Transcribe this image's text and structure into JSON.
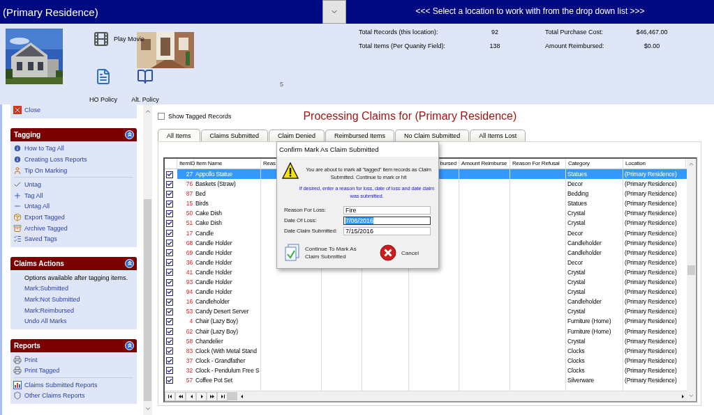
{
  "location_bar": {
    "value": "(Primary Residence)",
    "prompt": "<<< Select a location to work with from the drop down list >>>"
  },
  "header": {
    "launchers": [
      {
        "kind": "movie",
        "label": "Play Movie"
      },
      {
        "kind": "policy",
        "label": "HO Policy"
      },
      {
        "kind": "alt_policy",
        "label": "Alt. Policy"
      }
    ],
    "counter": "5",
    "stats": [
      {
        "label": "Total Records (this location):",
        "value": "92"
      },
      {
        "label": "Total Purchase Cost:",
        "value": "$46,467.00"
      },
      {
        "label": "Total Items (Per Quanity Field):",
        "value": "138"
      },
      {
        "label": "Amount Reimbursed:",
        "value": "$0.00"
      }
    ]
  },
  "sidebar": {
    "top_items": [
      {
        "kind": "close",
        "label": "Close"
      }
    ],
    "sections": [
      {
        "title": "Tagging",
        "groups": [
          [
            {
              "kind": "info",
              "label": "How to Tag All"
            },
            {
              "kind": "info",
              "label": "Creating Loss Reports"
            },
            {
              "kind": "tip",
              "label": "Tip On Marking"
            }
          ],
          [
            {
              "kind": "untag",
              "label": "Untag"
            },
            {
              "kind": "tag_all",
              "label": "Tag All"
            },
            {
              "kind": "untag_all",
              "label": "Untag All"
            },
            {
              "kind": "export",
              "label": "Export Tagged"
            },
            {
              "kind": "archive",
              "label": "Archive Tagged"
            },
            {
              "kind": "saved",
              "label": "Saved Tags"
            }
          ]
        ]
      },
      {
        "title": "Claims Actions",
        "groups": [
          [
            {
              "kind": "note",
              "label": "Options available after tagging items."
            },
            {
              "kind": "link",
              "label": "Mark:Submitted"
            },
            {
              "kind": "link",
              "label": "Mark:Not Submitted"
            },
            {
              "kind": "link",
              "label": "Mark:Reimbursed"
            },
            {
              "kind": "link",
              "label": "Undo All Marks"
            }
          ]
        ]
      },
      {
        "title": "Reports",
        "groups": [
          [
            {
              "kind": "print",
              "label": "Print"
            },
            {
              "kind": "print",
              "label": "Print Tagged"
            }
          ],
          [
            {
              "kind": "chart",
              "label": "Claims Submitted Reports"
            },
            {
              "kind": "shield",
              "label": "Other Claims Reports"
            }
          ]
        ]
      }
    ]
  },
  "show_tagged": {
    "label": "Show Tagged Records",
    "checked": false
  },
  "title": "Processing Claims for (Primary Residence)",
  "tabs": [
    {
      "label": "All Items",
      "selected": true
    },
    {
      "label": "Claims Submitted",
      "selected": false
    },
    {
      "label": "Claim Denied",
      "selected": false
    },
    {
      "label": "Reimbursed Items",
      "selected": false
    },
    {
      "label": "No Claim Submitted",
      "selected": false
    },
    {
      "label": "All Items Lost",
      "selected": false
    }
  ],
  "table": {
    "columns": [
      {},
      {
        "label": "ItemID"
      },
      {
        "label": "Item Name"
      },
      {
        "label": "Reas"
      },
      {},
      {},
      {
        "label": "bursed"
      },
      {
        "label": "Amount Reimburse"
      },
      {
        "label": "Reason For Refusal"
      },
      {
        "label": "Category"
      },
      {
        "label": "Location"
      }
    ],
    "rows": [
      {
        "tagged": true,
        "selected": true,
        "item_id": "27",
        "item_name": "Appollo Statue",
        "category": "Statues",
        "location": "(Primary Residence)"
      },
      {
        "tagged": true,
        "selected": false,
        "item_id": "76",
        "item_name": "Baskets (Straw)",
        "category": "Decor",
        "location": "(Primary Residence)"
      },
      {
        "tagged": true,
        "selected": false,
        "item_id": "87",
        "item_name": "Bed",
        "category": "Bedding",
        "location": "(Primary Residence)"
      },
      {
        "tagged": true,
        "selected": false,
        "item_id": "15",
        "item_name": "Birds",
        "category": "Statues",
        "location": "(Primary Residence)"
      },
      {
        "tagged": true,
        "selected": false,
        "item_id": "50",
        "item_name": "Cake Dish",
        "category": "Crystal",
        "location": "(Primary Residence)"
      },
      {
        "tagged": true,
        "selected": false,
        "item_id": "51",
        "item_name": "Cake Dish",
        "category": "Crystal",
        "location": "(Primary Residence)"
      },
      {
        "tagged": true,
        "selected": false,
        "item_id": "17",
        "item_name": "Candle",
        "category": "Decor",
        "location": "(Primary Residence)"
      },
      {
        "tagged": true,
        "selected": false,
        "item_id": "68",
        "item_name": "Candle Holder",
        "category": "Candleholder",
        "location": "(Primary Residence)"
      },
      {
        "tagged": true,
        "selected": false,
        "item_id": "69",
        "item_name": "Candle Holder",
        "category": "Candleholder",
        "location": "(Primary Residence)"
      },
      {
        "tagged": true,
        "selected": false,
        "item_id": "36",
        "item_name": "Candle Holder",
        "category": "Decor",
        "location": "(Primary Residence)"
      },
      {
        "tagged": true,
        "selected": false,
        "item_id": "41",
        "item_name": "Candle Holder",
        "category": "Crystal",
        "location": "(Primary Residence)"
      },
      {
        "tagged": true,
        "selected": false,
        "item_id": "93",
        "item_name": "Candle Holder",
        "category": "Crystal",
        "location": "(Primary Residence)"
      },
      {
        "tagged": true,
        "selected": false,
        "item_id": "94",
        "item_name": "Candle Holder",
        "category": "Crystal",
        "location": "(Primary Residence)"
      },
      {
        "tagged": true,
        "selected": false,
        "item_id": "16",
        "item_name": "Candleholder",
        "category": "Candleholder",
        "location": "(Primary Residence)"
      },
      {
        "tagged": true,
        "selected": false,
        "item_id": "53",
        "item_name": "Candy Desert Server",
        "category": "Crystal",
        "location": "(Primary Residence)"
      },
      {
        "tagged": true,
        "selected": false,
        "item_id": "4",
        "item_name": "Chair (Lazy Boy)",
        "category": "Furniture (Home)",
        "location": "(Primary Residence)"
      },
      {
        "tagged": true,
        "selected": false,
        "item_id": "62",
        "item_name": "Chair (Lazy Boy)",
        "category": "Furniture (Home)",
        "location": "(Primary Residence)"
      },
      {
        "tagged": true,
        "selected": false,
        "item_id": "58",
        "item_name": "Chandelier",
        "category": "Crystal",
        "location": "(Primary Residence)"
      },
      {
        "tagged": true,
        "selected": false,
        "item_id": "83",
        "item_name": "Clock (With Metal Stand",
        "category": "Clocks",
        "location": "(Primary Residence)"
      },
      {
        "tagged": true,
        "selected": false,
        "item_id": "37",
        "item_name": "Clock - Grandfather",
        "category": "Clocks",
        "location": "(Primary Residence)"
      },
      {
        "tagged": true,
        "selected": false,
        "item_id": "32",
        "item_name": "Clock - Pendulum Free S",
        "category": "Clocks",
        "location": "(Primary Residence)"
      },
      {
        "tagged": true,
        "selected": false,
        "item_id": "57",
        "item_name": "Coffee Pot Set",
        "category": "Silverware",
        "location": "(Primary Residence)"
      }
    ]
  },
  "dialog": {
    "title": "Confirm Mark As Claim Submitted",
    "message": "You are about to mark all \"tagged\" item records as Claim Submitted. Continue to mark or hit",
    "hint": "If desired, enter a reason for loss, date of loss and date claim was submitted.",
    "fields": [
      {
        "label": "Reason For Loss:",
        "value": "Fire",
        "focused": false
      },
      {
        "label": "Date Of Loss:",
        "value": "7/06/2016",
        "focused": true
      },
      {
        "label": "Date Claim Submitted:",
        "value": "7/15/2016",
        "focused": false
      }
    ],
    "confirm": "Continue To Mark As Claim Submitted",
    "cancel": "Cancel"
  }
}
